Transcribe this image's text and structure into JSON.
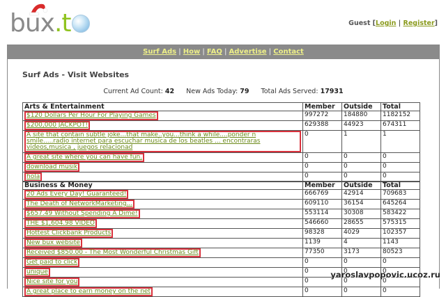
{
  "brand": {
    "logo_b": "b",
    "logo_ux": "ux",
    "logo_t": ".t"
  },
  "guest": {
    "label": "Guest [",
    "login": "Login",
    "sep": " | ",
    "register": "Register",
    "close": "]"
  },
  "nav": {
    "items": [
      "Surf Ads",
      "How",
      "FAQ",
      "Advertise",
      "Contact"
    ]
  },
  "page": {
    "title": "Surf Ads - Visit Websites"
  },
  "stats": {
    "current_label": "Current Ad Count:",
    "current_value": "42",
    "new_label": "New Ads Today:",
    "new_value": "79",
    "total_label": "Total Ads Served:",
    "total_value": "17931"
  },
  "columns": [
    "Member",
    "Outside",
    "Total"
  ],
  "categories": [
    {
      "name": "Arts & Entertainment",
      "rows": [
        [
          "$120 Dollars Per Hour For Playing Games",
          "997272",
          "184880",
          "1182152"
        ],
        [
          "$200,000 JACKPOT!",
          "629388",
          "44923",
          "674311"
        ],
        [
          "A site that contain subtle joke...that make..you...think a while....ponder n smile.....radio internet para escuchar musica de los beatles ... encontraras videos,musica , juegos relacionad",
          "0",
          "1",
          "1"
        ],
        [
          "A great site where you can have fun.",
          "0",
          "0",
          "0"
        ],
        [
          "download musik",
          "0",
          "0",
          "0"
        ],
        [
          "hola",
          "0",
          "0",
          "0"
        ]
      ]
    },
    {
      "name": "Business & Money",
      "rows": [
        [
          "20 Ads Every Day! Guaranteed!",
          "666769",
          "42914",
          "709683"
        ],
        [
          "The Death of NetworkMarketing...",
          "609110",
          "36154",
          "645264"
        ],
        [
          "$657.49 Without Spending A Dime!",
          "553114",
          "30308",
          "583422"
        ],
        [
          "THE $1,604.98 VIDEO",
          "546660",
          "28655",
          "575315"
        ],
        [
          "Hottest Clickbank Products",
          "98328",
          "4029",
          "102357"
        ],
        [
          "New bux website",
          "1139",
          "4",
          "1143"
        ],
        [
          "Received $850.00 - The Most Wonderful Christmas Gift",
          "77350",
          "3173",
          "80523"
        ],
        [
          "Get paid to click",
          "0",
          "0",
          "0"
        ],
        [
          "unique",
          "0",
          "0",
          "0"
        ],
        [
          "Nice site for you",
          "0",
          "0",
          "0"
        ],
        [
          "A great place to earn money on the net",
          "0",
          "0",
          "0"
        ]
      ]
    }
  ],
  "watermark": "yaroslavpopovic.ucoz.ru"
}
